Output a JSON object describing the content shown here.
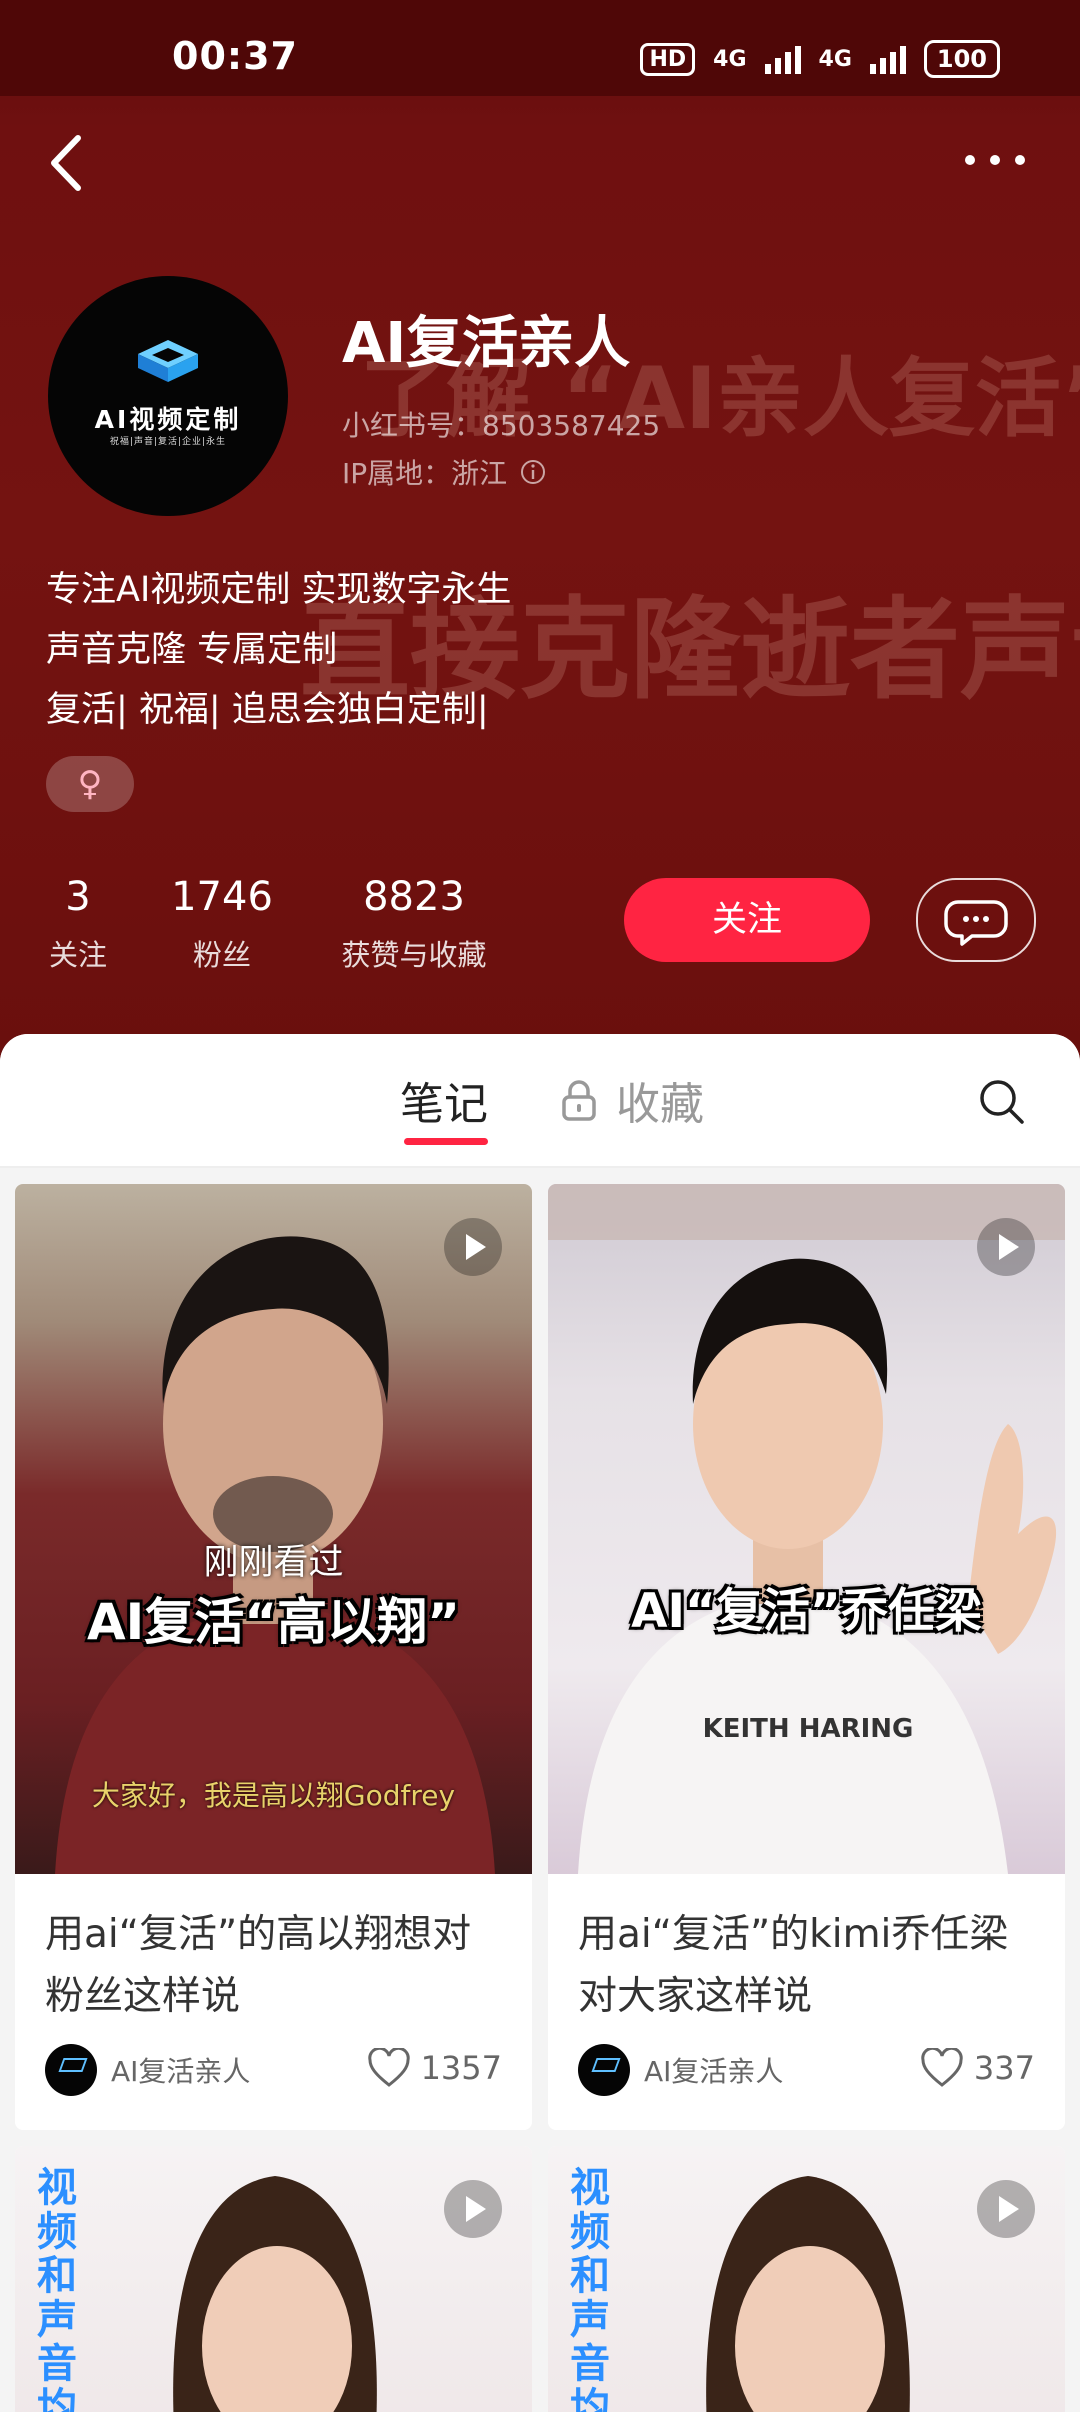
{
  "status_bar": {
    "time": "00:37",
    "hd_label": "HD",
    "net1": "4G",
    "net2": "4G",
    "battery": "100"
  },
  "profile": {
    "avatar_brand": "AI视频定制",
    "avatar_tagline": "祝福|声音|复活|企业|永生",
    "name": "AI复活亲人",
    "id_text": "小红书号：8503587425",
    "ip_text": "IP属地：浙江",
    "bio_lines": [
      "专注AI视频定制  实现数字永生",
      "声音克隆  专属定制",
      "复活| 祝福| 追思会独白定制|"
    ],
    "gender_symbol": "♀"
  },
  "background_watermark": {
    "line1": "了解 “AI亲人复活”",
    "line2": "直接克隆逝者声音"
  },
  "stats": [
    {
      "num": "3",
      "label": "关注"
    },
    {
      "num": "1746",
      "label": "粉丝"
    },
    {
      "num": "8823",
      "label": "获赞与收藏"
    }
  ],
  "actions": {
    "follow": "关注"
  },
  "tabs": {
    "notes": "笔记",
    "collections": "收藏"
  },
  "notes": [
    {
      "recent_label": "刚刚看过",
      "overlay_title": "AI复活“高以翔”",
      "overlay_sub": "大家好，我是高以翔Godfrey",
      "title": "用ai“复活”的高以翔想对粉丝这样说",
      "author": "AI复活亲人",
      "likes": "1357"
    },
    {
      "overlay_title": "AI“复活”乔任梁",
      "shirt_text": "KEITH HARING",
      "title": "用ai“复活”的kimi乔任梁对大家这样说",
      "author": "AI复活亲人",
      "likes": "337"
    },
    {
      "vertical_text": "视频和声音均由"
    },
    {
      "vertical_text": "视频和声音均由A"
    }
  ],
  "colors": {
    "accent": "#ff2442",
    "header_bg": "#741311",
    "status_bg": "#4f0707"
  }
}
